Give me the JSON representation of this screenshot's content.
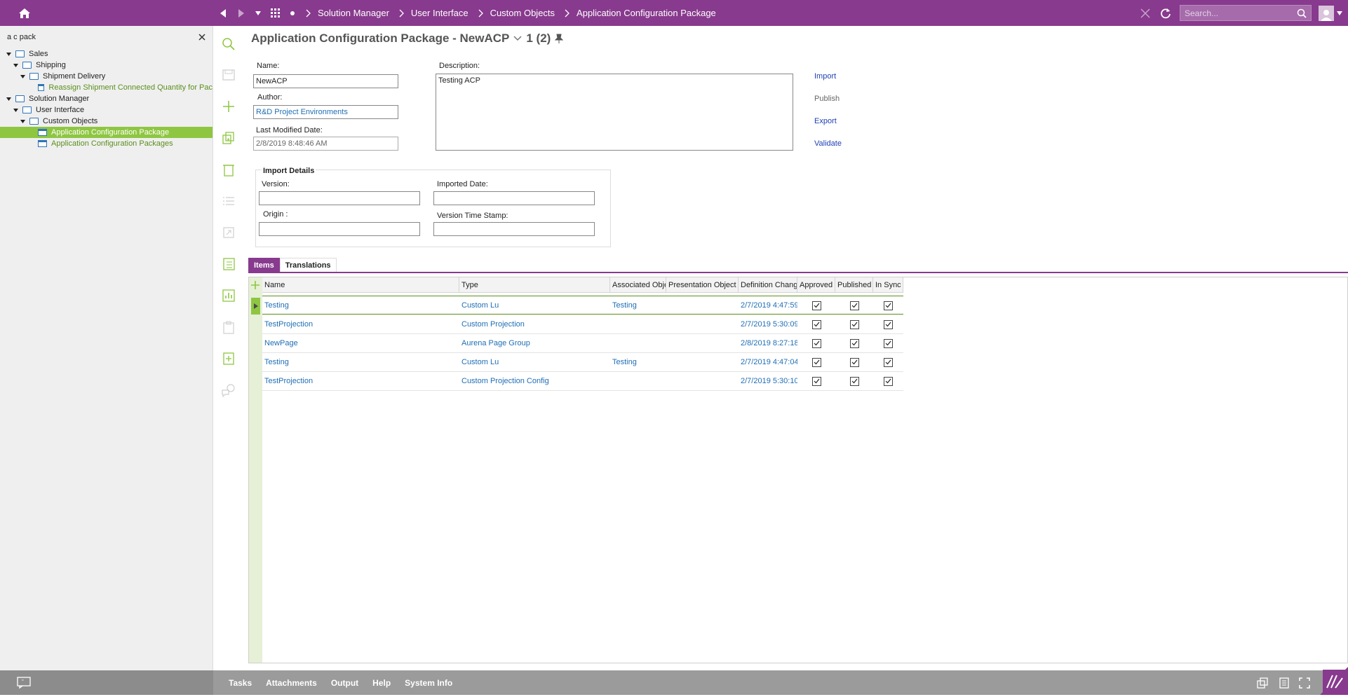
{
  "topbar": {
    "breadcrumbs": [
      "Solution Manager",
      "User Interface",
      "Custom Objects",
      "Application Configuration Package"
    ],
    "search_placeholder": "Search..."
  },
  "sidebar": {
    "search_text": "a c pack",
    "tree": [
      {
        "label": "Sales",
        "level": 0,
        "type": "folder",
        "expanded": true
      },
      {
        "label": "Shipping",
        "level": 1,
        "type": "folder",
        "expanded": true
      },
      {
        "label": "Shipment Delivery",
        "level": 2,
        "type": "folder",
        "expanded": true
      },
      {
        "label": "Reassign Shipment Connected Quantity for Pac",
        "level": 3,
        "type": "page"
      },
      {
        "label": "Solution Manager",
        "level": 0,
        "type": "folder",
        "expanded": true
      },
      {
        "label": "User Interface",
        "level": 1,
        "type": "folder",
        "expanded": true
      },
      {
        "label": "Custom Objects",
        "level": 2,
        "type": "folder",
        "expanded": true
      },
      {
        "label": "Application Configuration Package",
        "level": 3,
        "type": "page",
        "selected": true
      },
      {
        "label": "Application Configuration Packages",
        "level": 3,
        "type": "page"
      }
    ]
  },
  "header": {
    "title": "Application Configuration Package - NewACP",
    "record_count": "1 (2)"
  },
  "form": {
    "name_label": "Name:",
    "name_value": "NewACP",
    "description_label": "Description:",
    "description_value": "Testing ACP",
    "author_label": "Author:",
    "author_value": "R&D Project Environments",
    "last_modified_label": "Last Modified Date:",
    "last_modified_value": "2/8/2019 8:48:46 AM"
  },
  "commands": {
    "import": "Import",
    "publish": "Publish",
    "export": "Export",
    "validate": "Validate"
  },
  "import_details": {
    "title": "Import Details",
    "version_label": "Version:",
    "imported_date_label": "Imported Date:",
    "origin_label": "Origin :",
    "version_time_stamp_label": "Version Time Stamp:"
  },
  "tabs": [
    "Items",
    "Translations"
  ],
  "grid": {
    "columns": [
      "Name",
      "Type",
      "Associated Object",
      "Presentation Object",
      "Definition Changed",
      "Approved",
      "Published",
      "In Sync"
    ],
    "rows": [
      {
        "name": "Testing",
        "type": "Custom Lu",
        "assoc": "Testing",
        "pres": "",
        "changed": "2/7/2019 4:47:59...",
        "approved": true,
        "published": true,
        "insync": true
      },
      {
        "name": "TestProjection",
        "type": "Custom Projection",
        "assoc": "",
        "pres": "",
        "changed": "2/7/2019 5:30:09...",
        "approved": true,
        "published": true,
        "insync": true
      },
      {
        "name": "NewPage",
        "type": "Aurena Page Group",
        "assoc": "",
        "pres": "",
        "changed": "2/8/2019 8:27:18...",
        "approved": true,
        "published": true,
        "insync": true
      },
      {
        "name": "Testing",
        "type": "Custom Lu",
        "assoc": "Testing",
        "pres": "",
        "changed": "2/7/2019 4:47:04...",
        "approved": true,
        "published": true,
        "insync": true
      },
      {
        "name": "TestProjection",
        "type": "Custom Projection Config",
        "assoc": "",
        "pres": "",
        "changed": "2/7/2019 5:30:10...",
        "approved": true,
        "published": true,
        "insync": true
      }
    ]
  },
  "bottom": {
    "links": [
      "Tasks",
      "Attachments",
      "Output",
      "Help",
      "System Info"
    ]
  },
  "colors": {
    "brand_purple": "#883a8e",
    "accent_green": "#8ec641",
    "link_blue": "#1f6eb5"
  }
}
